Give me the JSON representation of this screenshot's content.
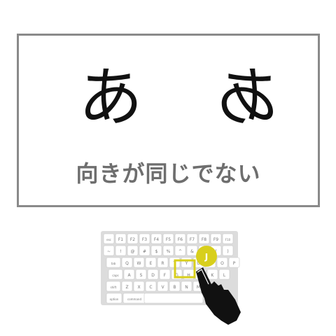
{
  "glyphs": {
    "normal": "あ",
    "mirrored": "あ"
  },
  "caption": "向きが同じでない",
  "keyboard": {
    "pressed_key": "J",
    "callout_key": "J",
    "accent_color": "#d8cf1c"
  },
  "key_rows": [
    [
      "esc",
      "F1",
      "F2",
      "F3",
      "F4",
      "F5",
      "F6",
      "F7",
      "F8",
      "F9",
      "F10"
    ],
    [
      "~",
      "!",
      "@",
      "#",
      "$",
      "%",
      "^",
      "&",
      "*",
      "(",
      ")"
    ],
    [
      "tab",
      "Q",
      "W",
      "E",
      "R",
      "T",
      "Y",
      "U",
      "I",
      "O",
      "P"
    ],
    [
      "caps",
      "A",
      "S",
      "D",
      "F",
      "G",
      "H",
      "J",
      "K",
      "L"
    ],
    [
      "shift",
      "Z",
      "X",
      "C",
      "V",
      "B",
      "N",
      "M"
    ],
    [
      "option",
      "command"
    ]
  ]
}
